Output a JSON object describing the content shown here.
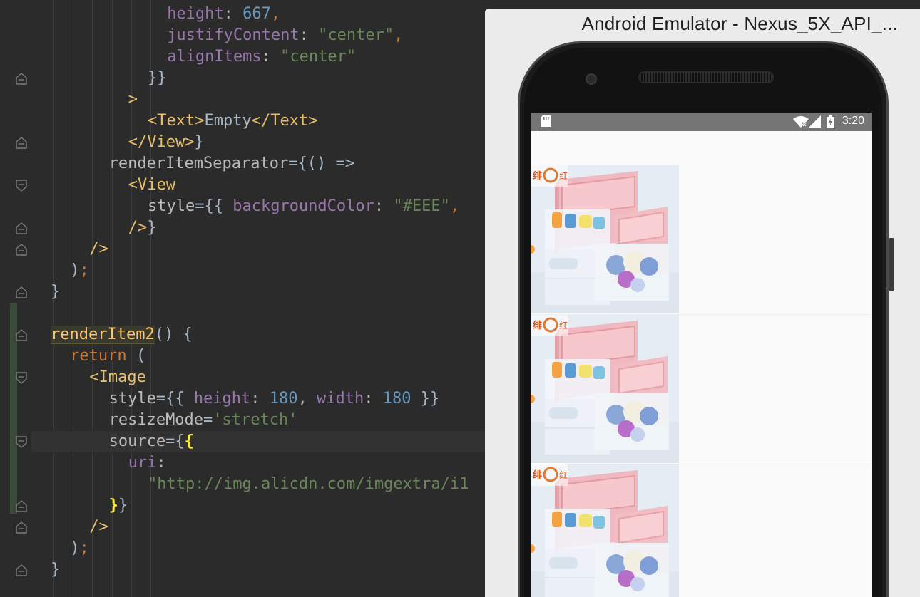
{
  "editor": {
    "lines": [
      {
        "indent": 6,
        "tokens": [
          {
            "t": "height",
            "c": "c-prop"
          },
          {
            "t": ": ",
            "c": "c-plain"
          },
          {
            "t": "667",
            "c": "c-num"
          },
          {
            "t": ",",
            "c": "c-kw"
          }
        ]
      },
      {
        "indent": 6,
        "tokens": [
          {
            "t": "justifyContent",
            "c": "c-prop"
          },
          {
            "t": ": ",
            "c": "c-plain"
          },
          {
            "t": "\"center\"",
            "c": "c-str"
          },
          {
            "t": ",",
            "c": "c-kw"
          }
        ]
      },
      {
        "indent": 6,
        "tokens": [
          {
            "t": "alignItems",
            "c": "c-prop"
          },
          {
            "t": ": ",
            "c": "c-plain"
          },
          {
            "t": "\"center\"",
            "c": "c-str"
          }
        ]
      },
      {
        "indent": 5,
        "tokens": [
          {
            "t": "}}",
            "c": "c-plain"
          }
        ]
      },
      {
        "indent": 4,
        "tokens": [
          {
            "t": ">",
            "c": "c-tag"
          }
        ]
      },
      {
        "indent": 5,
        "tokens": [
          {
            "t": "<Text>",
            "c": "c-tag"
          },
          {
            "t": "Empty",
            "c": "c-plain"
          },
          {
            "t": "</Text>",
            "c": "c-tag"
          }
        ]
      },
      {
        "indent": 4,
        "tokens": [
          {
            "t": "</View>",
            "c": "c-tag"
          },
          {
            "t": "}",
            "c": "c-plain"
          }
        ]
      },
      {
        "indent": 3,
        "tokens": [
          {
            "t": "renderItemSeparator",
            "c": "c-attr"
          },
          {
            "t": "={() =>",
            "c": "c-plain"
          }
        ]
      },
      {
        "indent": 4,
        "tokens": [
          {
            "t": "<View",
            "c": "c-tag"
          }
        ]
      },
      {
        "indent": 5,
        "tokens": [
          {
            "t": "style",
            "c": "c-attr"
          },
          {
            "t": "={{ ",
            "c": "c-plain"
          },
          {
            "t": "backgroundColor",
            "c": "c-prop"
          },
          {
            "t": ": ",
            "c": "c-plain"
          },
          {
            "t": "\"#EEE\"",
            "c": "c-str"
          },
          {
            "t": ",",
            "c": "c-kw"
          }
        ]
      },
      {
        "indent": 4,
        "tokens": [
          {
            "t": "/>",
            "c": "c-tag"
          },
          {
            "t": "}",
            "c": "c-plain"
          }
        ]
      },
      {
        "indent": 2,
        "tokens": [
          {
            "t": "/>",
            "c": "c-tag"
          }
        ]
      },
      {
        "indent": 1,
        "tokens": [
          {
            "t": ")",
            "c": "c-plain"
          },
          {
            "t": ";",
            "c": "c-kw"
          }
        ]
      },
      {
        "indent": 0,
        "tokens": [
          {
            "t": "}",
            "c": "c-plain"
          }
        ]
      },
      {
        "indent": 0,
        "tokens": []
      },
      {
        "indent": 0,
        "tokens": [
          {
            "t": "renderItem2",
            "c": "c-fn fn-hl"
          },
          {
            "t": "() {",
            "c": "c-plain"
          }
        ]
      },
      {
        "indent": 1,
        "tokens": [
          {
            "t": "return",
            "c": "c-kw"
          },
          {
            "t": " (",
            "c": "c-plain"
          }
        ]
      },
      {
        "indent": 2,
        "tokens": [
          {
            "t": "<Image",
            "c": "c-tag"
          }
        ]
      },
      {
        "indent": 3,
        "tokens": [
          {
            "t": "style",
            "c": "c-attr"
          },
          {
            "t": "={{ ",
            "c": "c-plain"
          },
          {
            "t": "height",
            "c": "c-prop"
          },
          {
            "t": ": ",
            "c": "c-plain"
          },
          {
            "t": "180",
            "c": "c-num"
          },
          {
            "t": ", ",
            "c": "c-plain"
          },
          {
            "t": "width",
            "c": "c-prop"
          },
          {
            "t": ": ",
            "c": "c-plain"
          },
          {
            "t": "180",
            "c": "c-num"
          },
          {
            "t": " }}",
            "c": "c-plain"
          }
        ]
      },
      {
        "indent": 3,
        "tokens": [
          {
            "t": "resizeMode",
            "c": "c-attr"
          },
          {
            "t": "=",
            "c": "c-plain"
          },
          {
            "t": "'stretch'",
            "c": "c-str"
          }
        ]
      },
      {
        "indent": 3,
        "current": true,
        "tokens": [
          {
            "t": "source",
            "c": "c-attr"
          },
          {
            "t": "={",
            "c": "c-plain"
          },
          {
            "t": "{",
            "c": "c-brace-hl"
          }
        ]
      },
      {
        "indent": 4,
        "tokens": [
          {
            "t": "uri",
            "c": "c-prop"
          },
          {
            "t": ":",
            "c": "c-plain"
          }
        ]
      },
      {
        "indent": 5,
        "tokens": [
          {
            "t": "\"http://img.alicdn.com/imgextra/i1",
            "c": "c-str"
          }
        ]
      },
      {
        "indent": 3,
        "tokens": [
          {
            "t": "}",
            "c": "c-brace-hl"
          },
          {
            "t": "}",
            "c": "c-plain"
          }
        ]
      },
      {
        "indent": 2,
        "tokens": [
          {
            "t": "/>",
            "c": "c-tag"
          }
        ]
      },
      {
        "indent": 1,
        "tokens": [
          {
            "t": ")",
            "c": "c-plain"
          },
          {
            "t": ";",
            "c": "c-kw"
          }
        ]
      },
      {
        "indent": 0,
        "tokens": [
          {
            "t": "}",
            "c": "c-plain"
          }
        ]
      }
    ]
  },
  "emulator": {
    "title": "Android Emulator - Nexus_5X_API_...",
    "status_time": "3:20",
    "icons": {
      "sd": "sd-card-icon",
      "wifi": "wifi-icon",
      "signal": "signal-icon",
      "battery": "battery-charging-icon"
    },
    "list_items": [
      {
        "brand": "绯",
        "brand2": "红"
      },
      {
        "brand": "绯",
        "brand2": "红"
      },
      {
        "brand": "绯",
        "brand2": "红"
      }
    ]
  }
}
